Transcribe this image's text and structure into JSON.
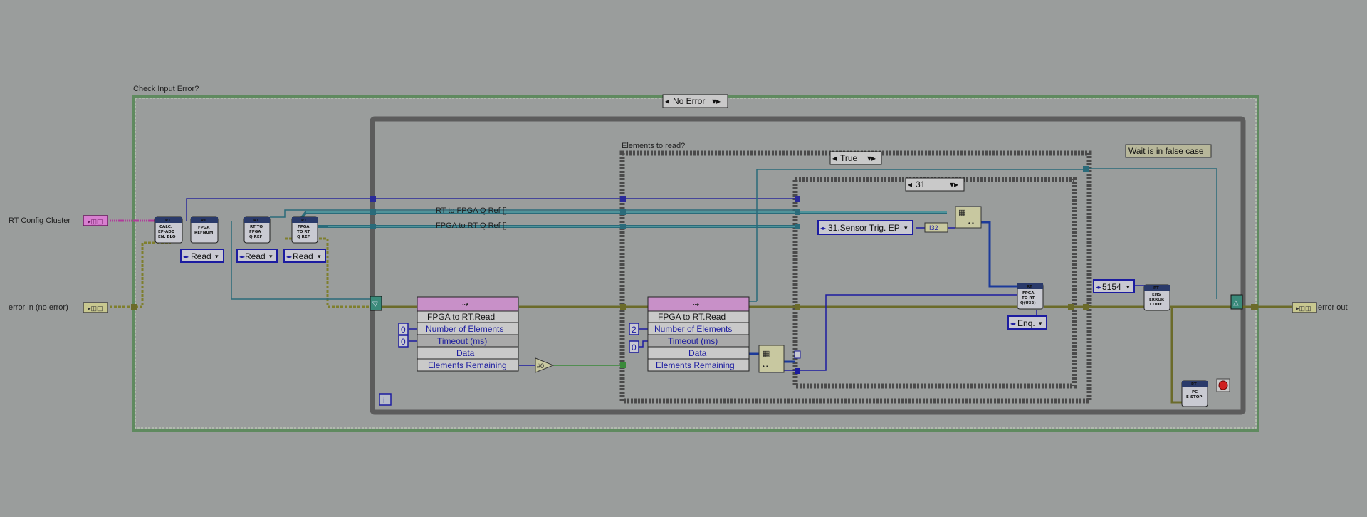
{
  "labels": {
    "case_outer_title": "Check Input Error?",
    "case_outer_selector": "No Error",
    "case_inner_title": "Elements to read?",
    "case_inner_selector": "True",
    "case_innermost_selector": "31",
    "note": "Wait is in false case",
    "rt_config_cluster": "RT Config Cluster",
    "error_in": "error in (no error)",
    "error_out": "error out",
    "wire_rt_to_fpga": "RT to FPGA Q Ref []",
    "wire_fpga_to_rt": "FPGA to RT Q Ref []",
    "loop_index": "i"
  },
  "subvis": {
    "calc": {
      "top": "RT",
      "body": [
        "CALC.",
        "EP-ADD",
        "EN. BLO"
      ]
    },
    "fpga_refnum": {
      "top": "RT",
      "body": [
        "FPGA",
        "REFNUM"
      ]
    },
    "rt_to_fpga_qref": {
      "top": "RT",
      "body": [
        "RT TO",
        "FPGA",
        "Q REF"
      ]
    },
    "fpga_to_rt_qref": {
      "top": "RT",
      "body": [
        "FPGA",
        "TO RT",
        "Q REF"
      ]
    },
    "fpga_to_rt_u32": {
      "top": "RT",
      "body": [
        "FPGA",
        "TO RT",
        "Q(U32)"
      ]
    },
    "ehs_error_code": {
      "top": "RT",
      "body": [
        "EHS",
        "ERROR",
        "CODE"
      ]
    },
    "pc_estop": {
      "top": "RT",
      "body": [
        "PC",
        "E-STOP"
      ]
    }
  },
  "enums": {
    "read_1": "Read",
    "read_2": "Read",
    "read_3": "Read",
    "sensor_trig": "31.Sensor Trig. EP",
    "enqueue": "Enq.",
    "type_i32": "I32",
    "error_code": "5154"
  },
  "read_node_1": {
    "title": "FPGA to RT.Read",
    "rows": [
      "Number of Elements",
      "Timeout (ms)",
      "Data",
      "Elements Remaining"
    ],
    "const_num_elements": "0",
    "const_timeout": "0"
  },
  "read_node_2": {
    "title": "FPGA to RT.Read",
    "rows": [
      "Number of Elements",
      "Timeout (ms)",
      "Data",
      "Elements Remaining"
    ],
    "const_num_elements": "2",
    "const_timeout": "0"
  },
  "compare": "#0"
}
